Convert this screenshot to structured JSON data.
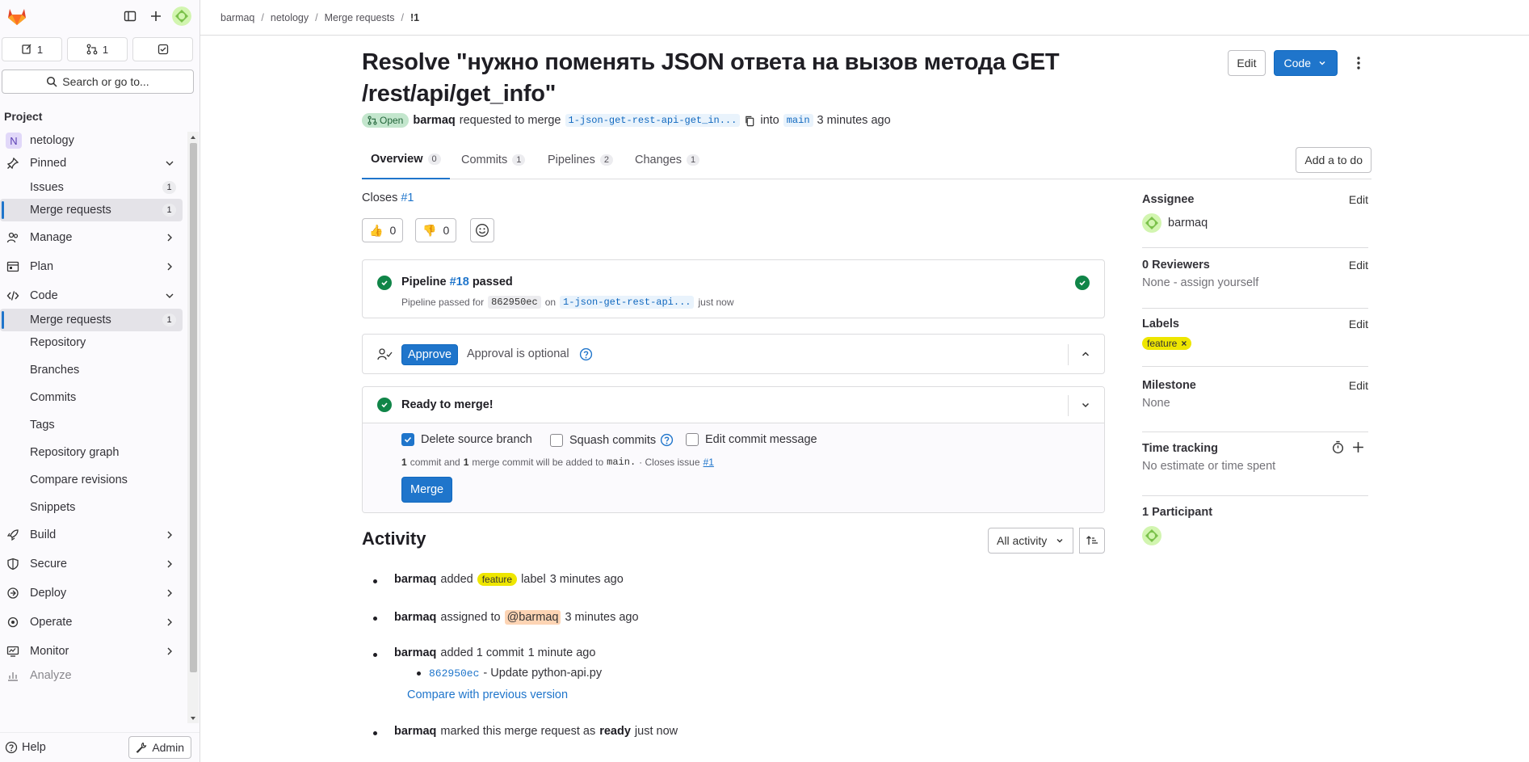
{
  "breadcrumb": [
    "barmaq",
    "netology",
    "Merge requests",
    "!1"
  ],
  "sidebar": {
    "counters": [
      {
        "icon": "issues-icon",
        "count": "1"
      },
      {
        "icon": "merge-request-icon",
        "count": "1"
      },
      {
        "icon": "todo-icon",
        "count": ""
      }
    ],
    "search_label": "Search or go to...",
    "section": "Project",
    "project_name": "netology",
    "project_initial": "N",
    "pinned": "Pinned",
    "pinned_items": [
      {
        "label": "Issues",
        "count": "1"
      },
      {
        "label": "Merge requests",
        "count": "1"
      }
    ],
    "items": [
      {
        "label": "Manage"
      },
      {
        "label": "Plan"
      },
      {
        "label": "Code"
      }
    ],
    "code_items": [
      {
        "label": "Merge requests",
        "count": "1"
      },
      {
        "label": "Repository"
      },
      {
        "label": "Branches"
      },
      {
        "label": "Commits"
      },
      {
        "label": "Tags"
      },
      {
        "label": "Repository graph"
      },
      {
        "label": "Compare revisions"
      },
      {
        "label": "Snippets"
      }
    ],
    "bottom_items": [
      {
        "label": "Build"
      },
      {
        "label": "Secure"
      },
      {
        "label": "Deploy"
      },
      {
        "label": "Operate"
      },
      {
        "label": "Monitor"
      },
      {
        "label": "Analyze"
      }
    ],
    "help": "Help",
    "admin": "Admin"
  },
  "mr": {
    "title": "Resolve \"нужно поменять JSON ответа на вызов метода GET /rest/api/get_info\"",
    "edit": "Edit",
    "code": "Code",
    "status": "Open",
    "author": "barmaq",
    "requested": "requested to merge",
    "source_branch": "1-json-get-rest-api-get_in...",
    "into": "into",
    "target_branch": "main",
    "time": "3 minutes ago"
  },
  "tabs": [
    {
      "label": "Overview",
      "count": "0"
    },
    {
      "label": "Commits",
      "count": "1"
    },
    {
      "label": "Pipelines",
      "count": "2"
    },
    {
      "label": "Changes",
      "count": "1"
    }
  ],
  "add_todo": "Add a to do",
  "closes": {
    "text": "Closes",
    "ref": "#1"
  },
  "awards": [
    {
      "emoji": "👍",
      "count": "0"
    },
    {
      "emoji": "👎",
      "count": "0"
    }
  ],
  "pipeline": {
    "prefix": "Pipeline",
    "id": "#18",
    "status": "passed",
    "sub_prefix": "Pipeline passed for",
    "sha": "862950ec",
    "on": "on",
    "branch": "1-json-get-rest-api...",
    "time": "just now"
  },
  "approval": {
    "button": "Approve",
    "text": "Approval is optional"
  },
  "merge": {
    "title": "Ready to merge!",
    "delete_branch": "Delete source branch",
    "squash": "Squash commits",
    "edit_msg": "Edit commit message",
    "info_1": "1",
    "info_2": "commit and",
    "info_3": "1",
    "info_4": "merge commit will be added to",
    "info_branch": "main.",
    "info_5": "· Closes issue",
    "info_ref": "#1",
    "button": "Merge"
  },
  "activity": {
    "title": "Activity",
    "filter": "All activity",
    "items": [
      {
        "user": "barmaq",
        "action": "added",
        "label": "feature",
        "suffix": "label",
        "time": "3 minutes ago"
      },
      {
        "user": "barmaq",
        "action": "assigned to",
        "mention": "@barmaq",
        "time": "3 minutes ago"
      },
      {
        "user": "barmaq",
        "action": "added 1 commit",
        "time": "1 minute ago",
        "commit_sha": "862950ec",
        "commit_msg": "- Update python-api.py",
        "compare": "Compare with previous version"
      },
      {
        "user": "barmaq",
        "action": "marked this merge request as",
        "strong": "ready",
        "time": "just now"
      }
    ]
  },
  "right": {
    "assignee_title": "Assignee",
    "assignee": "barmaq",
    "reviewers_title": "0 Reviewers",
    "reviewers_val": "None - assign yourself",
    "labels_title": "Labels",
    "label": "feature",
    "milestone_title": "Milestone",
    "milestone_val": "None",
    "time_title": "Time tracking",
    "time_val": "No estimate or time spent",
    "participants_title": "1 Participant",
    "edit": "Edit"
  },
  "colors": {
    "accent": "#1f75cb",
    "success": "#108548",
    "label": "#eee600"
  }
}
